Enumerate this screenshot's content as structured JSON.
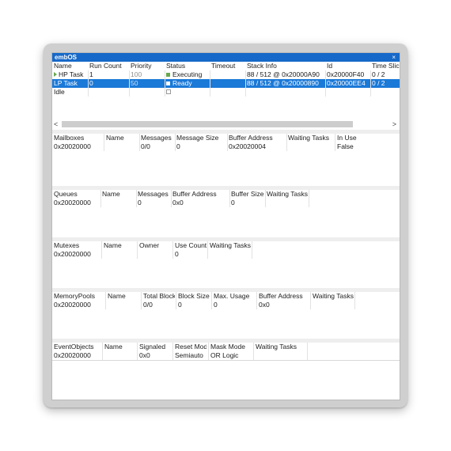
{
  "window": {
    "title": "embOS",
    "close_glyph": "×"
  },
  "tasks": {
    "columns": [
      "Name",
      "Run Count",
      "Priority",
      "Status",
      "Timeout",
      "Stack Info",
      "Id",
      "Time Slic"
    ],
    "rows": [
      {
        "name": "HP Task",
        "run_count": "1",
        "priority": "100",
        "status": "Executing",
        "timeout": "",
        "stack_info": "88 / 512 @ 0x20000A90",
        "id": "0x20000F40",
        "time_slice": "0 / 2",
        "selected": false
      },
      {
        "name": "LP Task",
        "run_count": "0",
        "priority": "50",
        "status": "Ready",
        "timeout": "",
        "stack_info": "88 / 512 @ 0x20000890",
        "id": "0x20000EE4",
        "time_slice": "0 / 2",
        "selected": true
      },
      {
        "name": "Idle",
        "run_count": "",
        "priority": "",
        "status": "",
        "timeout": "",
        "stack_info": "",
        "id": "",
        "time_slice": "",
        "selected": false
      }
    ],
    "scroll_left": "<",
    "scroll_right": ">"
  },
  "mailboxes": {
    "columns": [
      "Mailboxes",
      "Name",
      "Messages",
      "Message Size",
      "Buffer Address",
      "Waiting Tasks",
      "In Use"
    ],
    "row": [
      "0x20020000",
      "",
      "0/0",
      "0",
      "0x20020004",
      "",
      "False"
    ]
  },
  "queues": {
    "columns": [
      "Queues",
      "Name",
      "Messages",
      "Buffer Address",
      "Buffer Size",
      "Waiting Tasks"
    ],
    "row": [
      "0x20020000",
      "",
      "0",
      "0x0",
      "0",
      ""
    ]
  },
  "mutexes": {
    "columns": [
      "Mutexes",
      "Name",
      "Owner",
      "Use Count",
      "Waiting Tasks"
    ],
    "row": [
      "0x20020000",
      "",
      "",
      "0",
      ""
    ]
  },
  "memorypools": {
    "columns": [
      "MemoryPools",
      "Name",
      "Total Blocks",
      "Block Size",
      "Max. Usage",
      "Buffer Address",
      "Waiting Tasks"
    ],
    "row": [
      "0x20020000",
      "",
      "0/0",
      "0",
      "0",
      "0x0",
      ""
    ]
  },
  "eventobjects": {
    "columns": [
      "EventObjects",
      "Name",
      "Signaled",
      "Reset Mode",
      "Mask Mode",
      "Waiting Tasks"
    ],
    "row": [
      "0x20020000",
      "",
      "0x0",
      "Semiauto",
      "OR Logic",
      ""
    ]
  },
  "colors": {
    "title_bar": "#1769c9",
    "selection": "#1b79d8",
    "executing_icon": "#6aa84f",
    "ready_icon": "#ffffff"
  },
  "icons": {
    "current_task": "play-triangle-icon",
    "executing": "green-square-icon",
    "ready": "white-square-icon",
    "idle": "empty-square-icon"
  }
}
